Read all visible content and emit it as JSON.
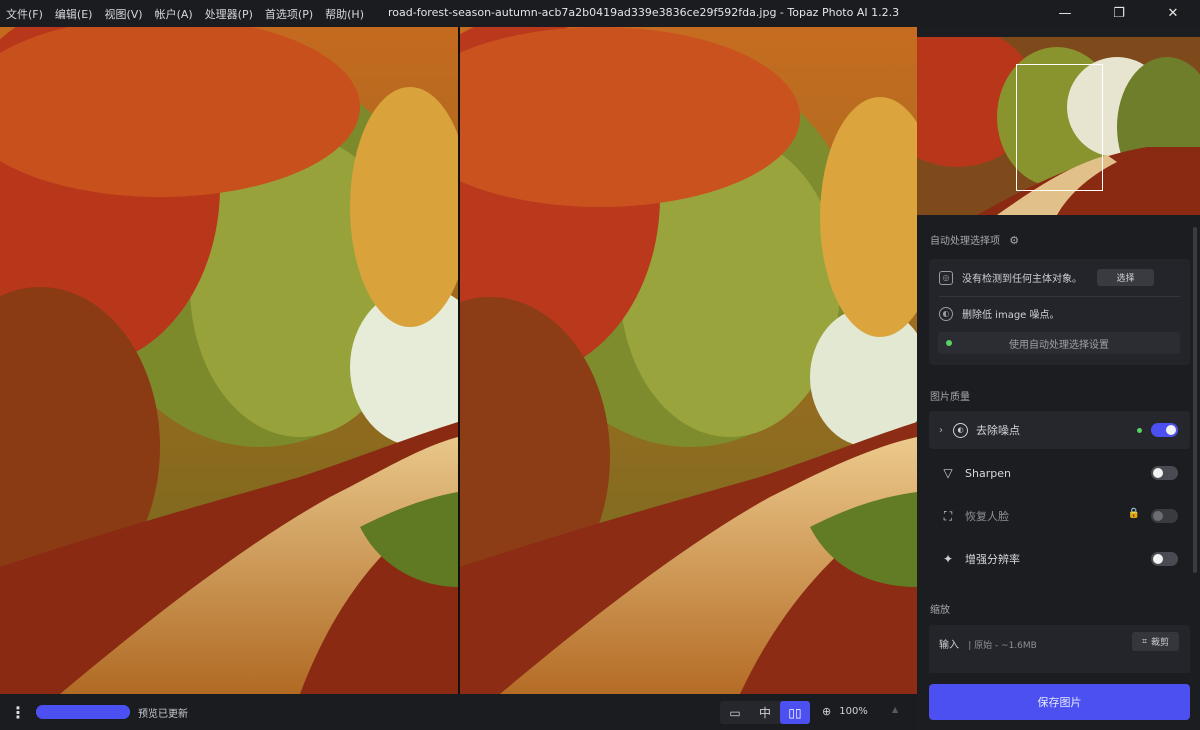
{
  "menu": [
    "文件(F)",
    "编辑(E)",
    "视图(V)",
    "帐户(A)",
    "处理器(P)",
    "首选项(P)",
    "帮助(H)"
  ],
  "window_title": "road-forest-season-autumn-acb7a2b0419ad339e3836ce29f592fda.jpg - Topaz Photo AI 1.2.3",
  "window_controls": {
    "minimize": "—",
    "restore": "❐",
    "close": "✕"
  },
  "bottom": {
    "more_icon": "⋮",
    "progress": 1.0,
    "status": "预览已更新",
    "view_single": "▭",
    "view_split": "中",
    "view_side": "▯▯",
    "zoom_icon": "⊕",
    "zoom": "100%",
    "zoom_caret": "▲"
  },
  "sidebar": {
    "auto_title": "自动处理选择项",
    "gear_icon": "⚙",
    "no_subject": "没有检测到任何主体对象。",
    "select_label": "选择",
    "denoise_low": "删除低 image 噪点。",
    "apply_auto": "使用自动处理选择设置",
    "quality_title": "图片质量",
    "items": [
      {
        "label": "去除噪点",
        "icon": "denoise-icon",
        "on": true,
        "expanded": true
      },
      {
        "label": "Sharpen",
        "icon": "sharpen-icon",
        "on": false
      },
      {
        "label": "恢复人脸",
        "icon": "face-icon",
        "on": false,
        "locked": true
      },
      {
        "label": "增强分辨率",
        "icon": "sparkle-icon",
        "on": false
      }
    ],
    "scale_title": "缩放",
    "input_label": "输入",
    "input_meta": "| 原始 -  ~1.6MB",
    "crop_label": "裁剪",
    "save_label": "保存图片"
  },
  "colors": {
    "accent": "#4c50f0",
    "active_dot": "#56d364",
    "panel": "#1c1d21"
  }
}
